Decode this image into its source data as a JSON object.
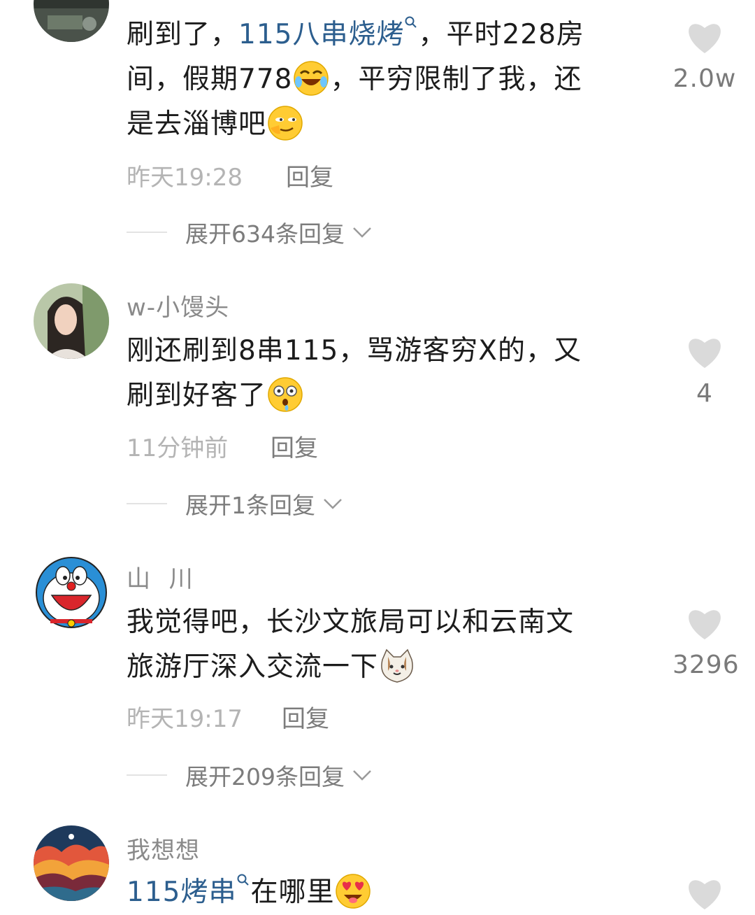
{
  "comments": [
    {
      "username": "",
      "lines": [
        {
          "link": "115八串烧烤",
          "pre": "刷到了，",
          "post": "，平时228房"
        },
        {
          "text": "间，假期778",
          "post": "，平穷限制了我，还"
        },
        {
          "text": "是去淄博吧"
        }
      ],
      "emojis": [
        "laughing-tears-emoji",
        "smirk-emoji"
      ],
      "time": "昨天19:28",
      "reply_label": "回复",
      "expand_label": "展开634条回复",
      "likes": "2.0w"
    },
    {
      "username": "w-小馒头",
      "lines": [
        {
          "text": "刚还刷到8串115，骂游客穷X的，又"
        },
        {
          "text": "刷到好客了"
        }
      ],
      "emojis": [
        "drooling-surprised-emoji"
      ],
      "time": "11分钟前",
      "reply_label": "回复",
      "expand_label": "展开1条回复",
      "likes": "4"
    },
    {
      "username": "山  川",
      "lines": [
        {
          "text": "我觉得吧，长沙文旅局可以和云南文"
        },
        {
          "text": "旅游厅深入交流一下"
        }
      ],
      "emojis": [
        "cat-face-emoji"
      ],
      "time": "昨天19:17",
      "reply_label": "回复",
      "expand_label": "展开209条回复",
      "likes": "3296"
    },
    {
      "username": "我想想",
      "lines": [
        {
          "link": "115烤串",
          "post": "在哪里"
        }
      ],
      "emojis": [
        "heart-eyes-emoji"
      ]
    }
  ],
  "colors": {
    "link": "#2c5e8e",
    "heart": "#dadada",
    "time": "#b4b4b4",
    "muted": "#7c7c7c"
  }
}
